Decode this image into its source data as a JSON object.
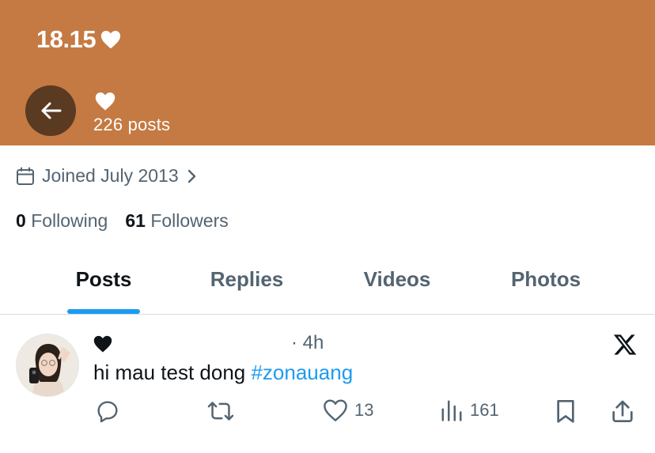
{
  "status_bar": {
    "time": "18.15",
    "heart_icon": "heart-icon"
  },
  "header": {
    "background_color": "#c47a42",
    "name_icon": "heart-icon",
    "posts_count": "226 posts"
  },
  "profile": {
    "joined": "Joined July 2013",
    "following_count": "0",
    "following_label": "Following",
    "followers_count": "61",
    "followers_label": "Followers"
  },
  "tabs": [
    {
      "label": "Posts",
      "active": true
    },
    {
      "label": "Replies",
      "active": false
    },
    {
      "label": "Videos",
      "active": false
    },
    {
      "label": "Photos",
      "active": false
    }
  ],
  "post": {
    "time": "· 4h",
    "text": "hi mau test dong ",
    "hashtag": "#zonauang",
    "like_count": "13",
    "view_count": "161"
  },
  "colors": {
    "accent": "#1d9bf0",
    "secondary_text": "#536471",
    "header": "#c47a42"
  }
}
